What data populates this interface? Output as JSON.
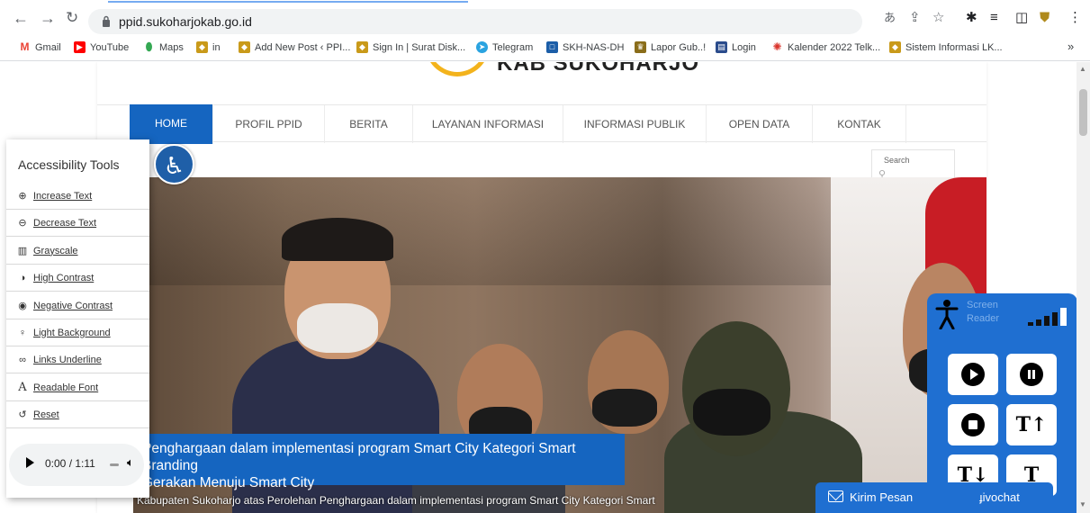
{
  "browser": {
    "url": "ppid.sukoharjokab.go.id",
    "bookmarks": [
      {
        "label": "Gmail",
        "icon": "gmail-icon",
        "color": "#ea4335"
      },
      {
        "label": "YouTube",
        "icon": "youtube-icon",
        "color": "#ff0000"
      },
      {
        "label": "Maps",
        "icon": "maps-icon",
        "color": "#34a853"
      },
      {
        "label": "in",
        "icon": "site-icon",
        "color": "#c99a1a"
      },
      {
        "label": "Add New Post ‹ PPI...",
        "icon": "site-icon",
        "color": "#c99a1a"
      },
      {
        "label": "Sign In | Surat Disk...",
        "icon": "site-icon",
        "color": "#c99a1a"
      },
      {
        "label": "Telegram",
        "icon": "telegram-icon",
        "color": "#2aa3e0"
      },
      {
        "label": "SKH-NAS-DH",
        "icon": "nas-icon",
        "color": "#1c5ea8"
      },
      {
        "label": "Lapor Gub..!",
        "icon": "lapor-icon",
        "color": "#8a6d1a"
      },
      {
        "label": "Login",
        "icon": "login-icon",
        "color": "#2b4c8c"
      },
      {
        "label": "Kalender 2022 Telk...",
        "icon": "calendar-icon",
        "color": "#d9342b"
      },
      {
        "label": "Sistem Informasi LK...",
        "icon": "site-icon",
        "color": "#c99a1a"
      }
    ],
    "more": "»"
  },
  "site": {
    "logo_text": "KAB SUKOHARJO",
    "menu": [
      {
        "label": "HOME",
        "active": true
      },
      {
        "label": "PROFIL PPID"
      },
      {
        "label": "BERITA"
      },
      {
        "label": "LAYANAN INFORMASI"
      },
      {
        "label": "INFORMASI PUBLIK"
      },
      {
        "label": "OPEN DATA"
      },
      {
        "label": "KONTAK"
      }
    ],
    "search_label": "Search",
    "hero_caption_line1": "Penghargaan dalam implementasi program Smart City Kategori Smart Branding",
    "hero_caption_line2": "Gerakan Menuju Smart City",
    "hero_sub": "Kabupaten Sukoharjo atas Perolehan Penghargaan dalam implementasi program Smart City Kategori Smart"
  },
  "accessibility": {
    "title": "Accessibility Tools",
    "items": [
      {
        "label": "Increase Text",
        "icon": "zoom-in-icon"
      },
      {
        "label": "Decrease Text",
        "icon": "zoom-out-icon"
      },
      {
        "label": "Grayscale",
        "icon": "grayscale-icon"
      },
      {
        "label": "High Contrast",
        "icon": "contrast-icon"
      },
      {
        "label": "Negative Contrast",
        "icon": "eye-icon"
      },
      {
        "label": "Light Background",
        "icon": "bulb-icon"
      },
      {
        "label": "Links Underline",
        "icon": "link-icon"
      },
      {
        "label": "Readable Font",
        "icon": "font-icon"
      },
      {
        "label": "Reset",
        "icon": "reset-icon"
      }
    ],
    "player_time": "0:00 / 1:11"
  },
  "screen_reader": {
    "label_line1": "Screen",
    "label_line2": "Reader",
    "buttons": [
      "play",
      "pause",
      "stop",
      "T↑",
      "T↓",
      "T"
    ]
  },
  "chat": {
    "send_label": "Kirim Pesan",
    "brand": "ɟivochat"
  },
  "colors": {
    "primary": "#1565c0",
    "widget_blue": "#1f6fd1",
    "accent_gold": "#f3b31c"
  }
}
